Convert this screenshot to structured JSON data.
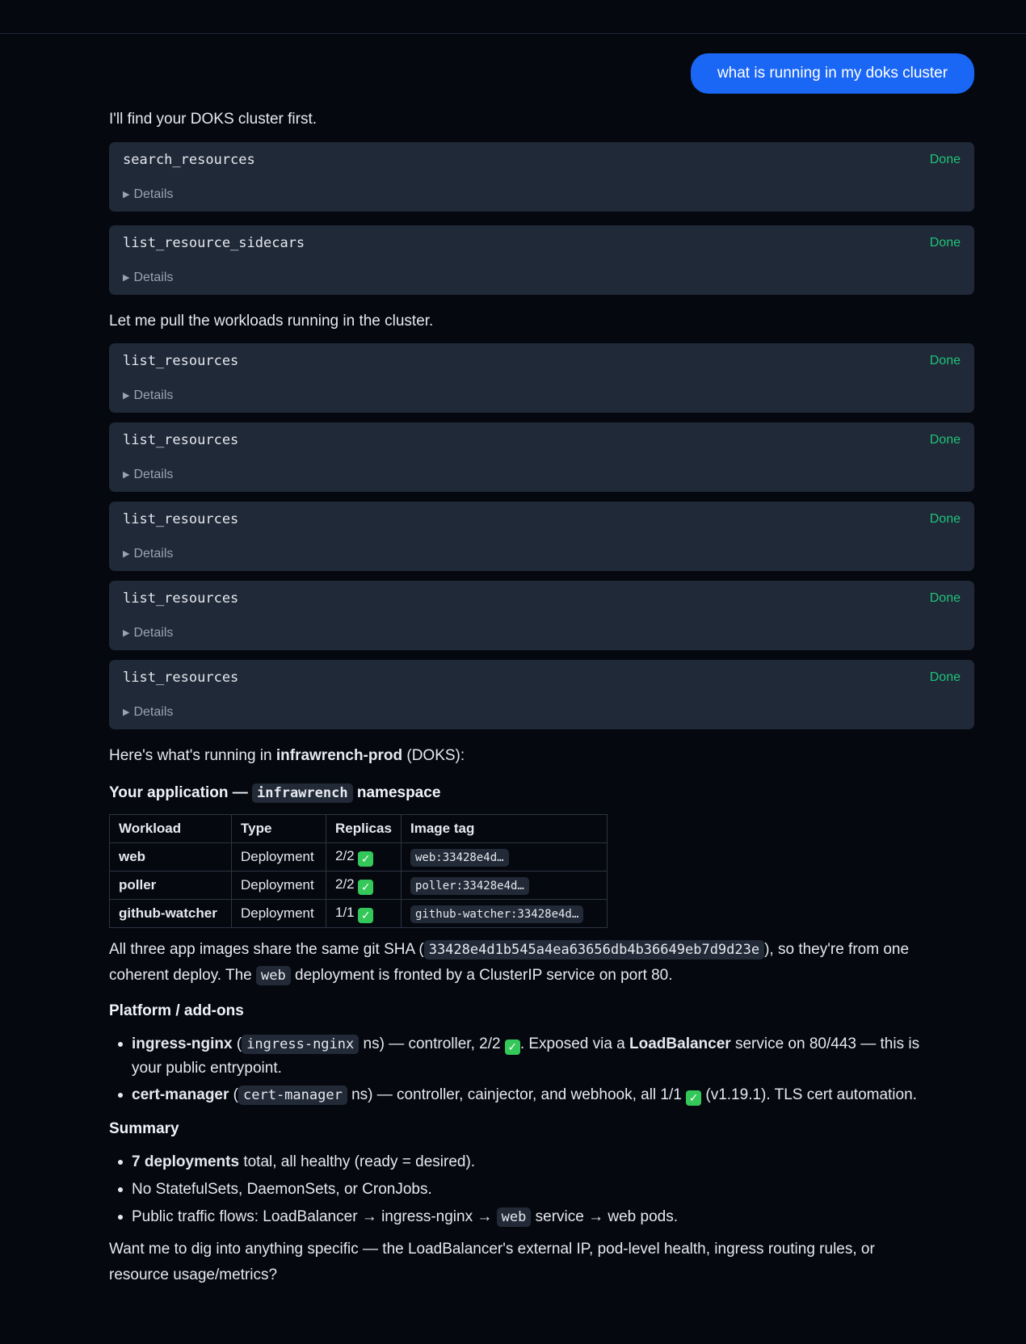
{
  "user_message": "what is running in my doks cluster",
  "assistant": {
    "intro": "I'll find your DOKS cluster first.",
    "tool_calls_1": [
      {
        "name": "search_resources",
        "status": "Done",
        "details_label": "Details"
      },
      {
        "name": "list_resource_sidecars",
        "status": "Done",
        "details_label": "Details"
      }
    ],
    "pull_text": "Let me pull the workloads running in the cluster.",
    "tool_calls_2": [
      {
        "name": "list_resources",
        "status": "Done",
        "details_label": "Details"
      },
      {
        "name": "list_resources",
        "status": "Done",
        "details_label": "Details"
      },
      {
        "name": "list_resources",
        "status": "Done",
        "details_label": "Details"
      },
      {
        "name": "list_resources",
        "status": "Done",
        "details_label": "Details"
      },
      {
        "name": "list_resources",
        "status": "Done",
        "details_label": "Details"
      }
    ],
    "summary_intro": {
      "pre": "Here's what's running in ",
      "cluster": "infrawrench-prod",
      "post": " (DOKS):"
    },
    "app_heading": {
      "pre": "Your application — ",
      "namespace": "infrawrench",
      "post": " namespace"
    },
    "table": {
      "headers": [
        "Workload",
        "Type",
        "Replicas",
        "Image tag"
      ],
      "rows": [
        {
          "workload": "web",
          "type": "Deployment",
          "replicas": "2/2",
          "image": "web:33428e4d…"
        },
        {
          "workload": "poller",
          "type": "Deployment",
          "replicas": "2/2",
          "image": "poller:33428e4d…"
        },
        {
          "workload": "github-watcher",
          "type": "Deployment",
          "replicas": "1/1",
          "image": "github-watcher:33428e4d…"
        }
      ]
    },
    "sha_para": {
      "t1": "All three app images share the same git SHA (",
      "sha": "33428e4d1b545a4ea63656db4b36649eb7d9d23e",
      "t2": "), so they're from one",
      "t3": "coherent deploy. The ",
      "web": "web",
      "t4": " deployment is fronted by a ClusterIP service on port 80."
    },
    "platform_heading": "Platform / add-ons",
    "platform": [
      {
        "name": "ingress-nginx",
        "ns_open": " (",
        "ns": "ingress-nginx",
        "t1": " ns) — controller, 2/2 ",
        "t2": ". Exposed via a ",
        "bold2": "LoadBalancer",
        "t3": " service on 80/443 — this is",
        "t4": "your public entrypoint."
      },
      {
        "name": "cert-manager",
        "ns_open": " (",
        "ns": "cert-manager",
        "t1": " ns) — controller, cainjector, and webhook, all 1/1 ",
        "t2": " (v1.19.1). TLS cert automation."
      }
    ],
    "summary_heading": "Summary",
    "summary": [
      {
        "bold": "7 deployments",
        "text": " total, all healthy (ready = desired)."
      },
      {
        "text": "No StatefulSets, DaemonSets, or CronJobs."
      },
      {
        "t1": "Public traffic flows: LoadBalancer → ingress-nginx → ",
        "code": "web",
        "t2": " service → web pods."
      }
    ],
    "closing": {
      "line1": "Want me to dig into anything specific — the LoadBalancer's external IP, pod-level health, ingress routing rules, or",
      "line2": "resource usage/metrics?"
    }
  },
  "colors": {
    "background": "#05080f",
    "card": "#1f2937",
    "accent_blue": "#1a66f5",
    "done_green": "#22c27a",
    "check_green": "#34c759"
  },
  "icons": {
    "check": "check-emoji-icon",
    "details": "triangle-right-icon"
  }
}
